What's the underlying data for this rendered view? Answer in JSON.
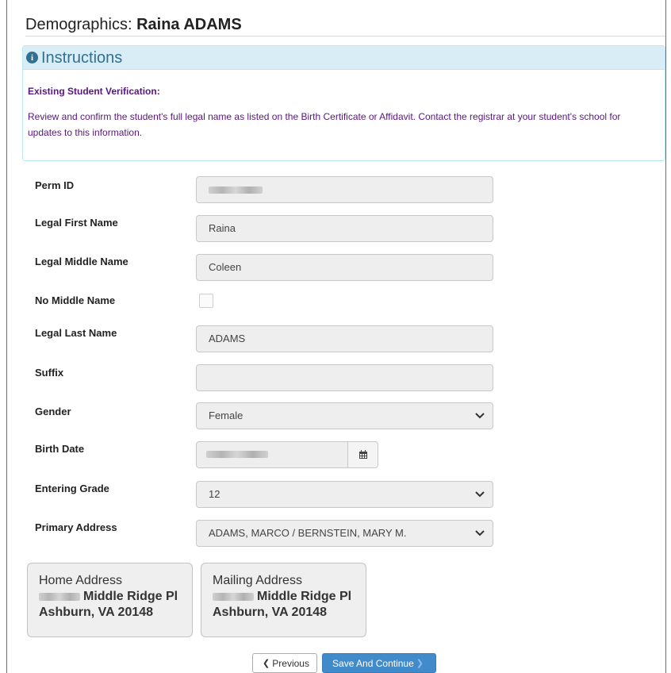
{
  "page": {
    "title_prefix": "Demographics:",
    "title_name": "Raina ADAMS"
  },
  "instructions": {
    "heading": "Instructions",
    "subheading": "Existing Student Verification:",
    "body": "Review and confirm the student's full legal name as listed on the Birth Certificate or Affidavit. Contact the registrar at your student's school for updates to this information."
  },
  "form": {
    "perm_id": {
      "label": "Perm ID",
      "value": ""
    },
    "first_name": {
      "label": "Legal First Name",
      "value": "Raina"
    },
    "middle_name": {
      "label": "Legal Middle Name",
      "value": "Coleen"
    },
    "no_middle_name": {
      "label": "No Middle Name",
      "checked": false
    },
    "last_name": {
      "label": "Legal Last Name",
      "value": "ADAMS"
    },
    "suffix": {
      "label": "Suffix",
      "value": ""
    },
    "gender": {
      "label": "Gender",
      "value": "Female"
    },
    "birth_date": {
      "label": "Birth Date",
      "value": ""
    },
    "entering_grade": {
      "label": "Entering Grade",
      "value": "12"
    },
    "primary_address": {
      "label": "Primary Address",
      "value": "ADAMS, MARCO / BERNSTEIN, MARY M."
    }
  },
  "addresses": {
    "home": {
      "title": "Home Address",
      "street": "Middle Ridge Pl",
      "city": "Ashburn, VA 20148"
    },
    "mailing": {
      "title": "Mailing Address",
      "street": "Middle Ridge Pl",
      "city": "Ashburn, VA 20148"
    }
  },
  "buttons": {
    "previous": "Previous",
    "next": "Save And Continue"
  },
  "icons": {
    "info": "info-circle-icon",
    "calendar": "calendar-icon",
    "caret": "chevron-down-icon",
    "prev": "chevron-left-icon",
    "next": "chevron-right-icon"
  },
  "colors": {
    "instructions_bg": "#d9edf7",
    "instructions_text": "#31708f",
    "instruction_body_text": "#5a1680",
    "primary_button": "#428bca"
  }
}
